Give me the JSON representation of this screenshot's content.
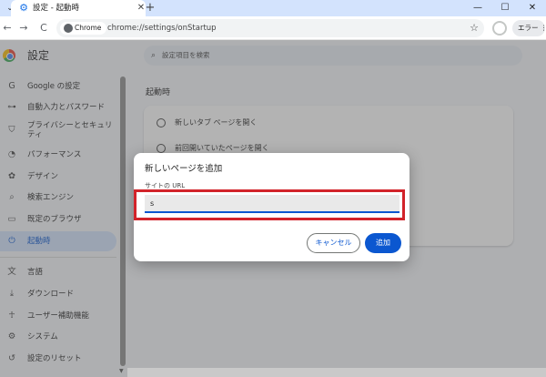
{
  "browser": {
    "tab_title": "設定 - 起動時",
    "url_chip": "Chrome",
    "url": "chrome://settings/onStartup",
    "profile_error": "エラー"
  },
  "settings": {
    "title": "設定",
    "search_placeholder": "設定項目を検索",
    "sidebar": {
      "items": [
        {
          "label": "Google の設定",
          "icon": "G"
        },
        {
          "label": "自動入力とパスワード",
          "icon": "⊶"
        },
        {
          "label": "プライバシーとセキュリティ",
          "icon": "⛉"
        },
        {
          "label": "パフォーマンス",
          "icon": "◔"
        },
        {
          "label": "デザイン",
          "icon": "✿"
        },
        {
          "label": "検索エンジン",
          "icon": "⌕"
        },
        {
          "label": "既定のブラウザ",
          "icon": "▭"
        },
        {
          "label": "起動時",
          "icon": "⏻"
        },
        {
          "label": "言語",
          "icon": "文"
        },
        {
          "label": "ダウンロード",
          "icon": "⤓"
        },
        {
          "label": "ユーザー補助機能",
          "icon": "☥"
        },
        {
          "label": "システム",
          "icon": "⚙"
        },
        {
          "label": "設定のリセット",
          "icon": "↺"
        }
      ]
    },
    "section_title": "起動時",
    "options": [
      {
        "label": "新しいタブ ページを開く"
      },
      {
        "label": "前回開いていたページを開く"
      }
    ]
  },
  "dialog": {
    "title": "新しいページを追加",
    "field_label": "サイトの URL",
    "field_value": "s",
    "cancel_label": "キャンセル",
    "add_label": "追加"
  },
  "colors": {
    "accent": "#0b57d0",
    "highlight": "#d2232a"
  }
}
